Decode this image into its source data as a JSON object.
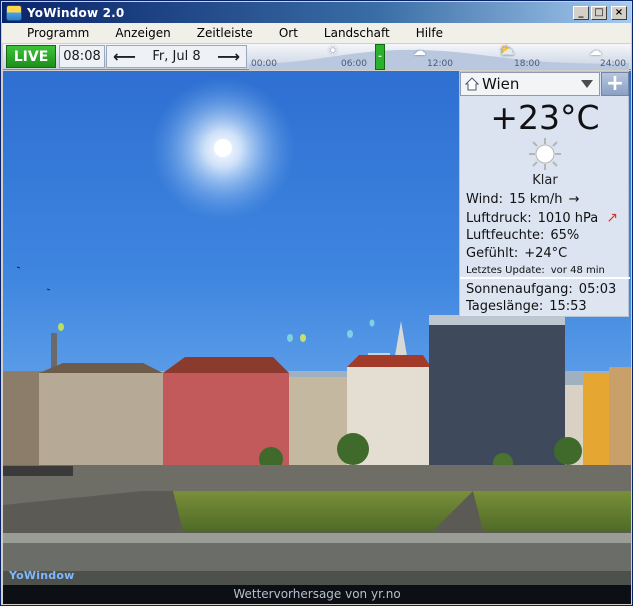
{
  "window": {
    "title": "YoWindow 2.0"
  },
  "menu": [
    "Programm",
    "Anzeigen",
    "Zeitleiste",
    "Ort",
    "Landschaft",
    "Hilfe"
  ],
  "timeline": {
    "live_label": "LIVE",
    "time": "08:08",
    "date": "Fr, Jul 8",
    "ticks": [
      "00:00",
      "06:00",
      "12:00",
      "18:00",
      "24:00"
    ],
    "now_marker": "-"
  },
  "weather": {
    "city": "Wien",
    "temperature": "+23°C",
    "condition": "Klar",
    "wind_label": "Wind:",
    "wind_value": "15 km/h",
    "pressure_label": "Luftdruck:",
    "pressure_value": "1010 hPa",
    "humidity_label": "Luftfeuchte:",
    "humidity_value": "65%",
    "feels_label": "Gefühlt:",
    "feels_value": "+24°C",
    "update_label": "Letztes Update:",
    "update_value": "vor 48 min",
    "sunrise_label": "Sonnenaufgang:",
    "sunrise_value": "05:03",
    "daylength_label": "Tageslänge:",
    "daylength_value": "15:53"
  },
  "footer": {
    "credit": "Wettervorhersage von yr.no",
    "logo": "YoWindow"
  },
  "colors": {
    "live_green": "#2bb22a",
    "sky_top": "#2e6fd1",
    "pressure_arrow": "#d13a2a"
  }
}
